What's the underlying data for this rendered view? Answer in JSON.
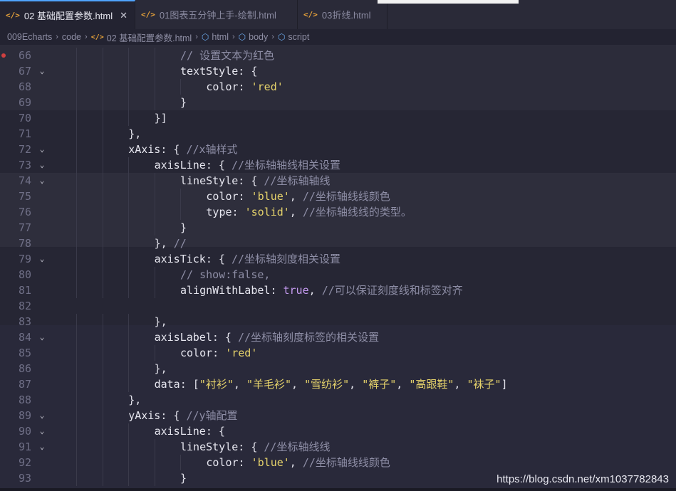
{
  "tabs": [
    {
      "icon": "</>",
      "label": "02 基础配置参数.html",
      "active": true,
      "close": "✕"
    },
    {
      "icon": "</>",
      "label": "01图表五分钟上手-绘制.html",
      "active": false
    },
    {
      "icon": "</>",
      "label": "03折线.html",
      "active": false
    }
  ],
  "breadcrumb": {
    "items": [
      "009Echarts",
      "code",
      "02 基础配置参数.html",
      "html",
      "body",
      "script"
    ],
    "separator": "›"
  },
  "editor": {
    "lines": [
      {
        "n": "66",
        "fold": false,
        "indent": 5,
        "tokens": [
          [
            "t-comment",
            "// 设置文本为红色"
          ]
        ]
      },
      {
        "n": "67",
        "fold": true,
        "indent": 5,
        "tokens": [
          [
            "t-key",
            "textStyle"
          ],
          [
            "t-punc",
            ": {"
          ]
        ]
      },
      {
        "n": "68",
        "fold": false,
        "indent": 6,
        "tokens": [
          [
            "t-key",
            "color"
          ],
          [
            "t-punc",
            ": "
          ],
          [
            "t-str",
            "'red'"
          ]
        ]
      },
      {
        "n": "69",
        "fold": false,
        "indent": 5,
        "tokens": [
          [
            "t-punc",
            "}"
          ]
        ]
      },
      {
        "n": "70",
        "fold": false,
        "indent": 4,
        "tokens": [
          [
            "t-punc",
            "}]"
          ]
        ]
      },
      {
        "n": "71",
        "fold": false,
        "indent": 3,
        "tokens": [
          [
            "t-punc",
            "},"
          ]
        ]
      },
      {
        "n": "72",
        "fold": true,
        "indent": 3,
        "tokens": [
          [
            "t-key",
            "xAxis"
          ],
          [
            "t-punc",
            ": { "
          ],
          [
            "t-comment",
            "//x轴样式"
          ]
        ]
      },
      {
        "n": "73",
        "fold": true,
        "indent": 4,
        "tokens": [
          [
            "t-key",
            "axisLine"
          ],
          [
            "t-punc",
            ": { "
          ],
          [
            "t-comment",
            "//坐标轴轴线相关设置"
          ]
        ]
      },
      {
        "n": "74",
        "fold": true,
        "indent": 5,
        "tokens": [
          [
            "t-key",
            "lineStyle"
          ],
          [
            "t-punc",
            ": { "
          ],
          [
            "t-comment",
            "//坐标轴轴线"
          ]
        ]
      },
      {
        "n": "75",
        "fold": false,
        "indent": 6,
        "tokens": [
          [
            "t-key",
            "color"
          ],
          [
            "t-punc",
            ": "
          ],
          [
            "t-str",
            "'blue'"
          ],
          [
            "t-punc",
            ", "
          ],
          [
            "t-comment",
            "//坐标轴线线颜色"
          ]
        ]
      },
      {
        "n": "76",
        "fold": false,
        "indent": 6,
        "tokens": [
          [
            "t-key",
            "type"
          ],
          [
            "t-punc",
            ": "
          ],
          [
            "t-str",
            "'solid'"
          ],
          [
            "t-punc",
            ", "
          ],
          [
            "t-comment",
            "//坐标轴线线的类型。"
          ]
        ]
      },
      {
        "n": "77",
        "fold": false,
        "indent": 5,
        "tokens": [
          [
            "t-punc",
            "}"
          ]
        ]
      },
      {
        "n": "78",
        "fold": false,
        "indent": 4,
        "tokens": [
          [
            "t-punc",
            "}, "
          ],
          [
            "t-comment",
            "//"
          ]
        ]
      },
      {
        "n": "79",
        "fold": true,
        "indent": 4,
        "tokens": [
          [
            "t-key",
            "axisTick"
          ],
          [
            "t-punc",
            ": { "
          ],
          [
            "t-comment",
            "//坐标轴刻度相关设置"
          ]
        ]
      },
      {
        "n": "80",
        "fold": false,
        "indent": 5,
        "tokens": [
          [
            "t-comment",
            "// show:false,"
          ]
        ]
      },
      {
        "n": "81",
        "fold": false,
        "indent": 5,
        "tokens": [
          [
            "t-key",
            "alignWithLabel"
          ],
          [
            "t-punc",
            ": "
          ],
          [
            "t-bool",
            "true"
          ],
          [
            "t-punc",
            ", "
          ],
          [
            "t-comment",
            "//可以保证刻度线和标签对齐"
          ]
        ]
      },
      {
        "n": "82",
        "fold": false,
        "indent": 0,
        "tokens": []
      },
      {
        "n": "83",
        "fold": false,
        "indent": 4,
        "tokens": [
          [
            "t-punc",
            "},"
          ]
        ]
      },
      {
        "n": "84",
        "fold": true,
        "indent": 4,
        "tokens": [
          [
            "t-key",
            "axisLabel"
          ],
          [
            "t-punc",
            ": { "
          ],
          [
            "t-comment",
            "//坐标轴刻度标签的相关设置"
          ]
        ]
      },
      {
        "n": "85",
        "fold": false,
        "indent": 5,
        "tokens": [
          [
            "t-key",
            "color"
          ],
          [
            "t-punc",
            ": "
          ],
          [
            "t-str",
            "'red'"
          ]
        ]
      },
      {
        "n": "86",
        "fold": false,
        "indent": 4,
        "tokens": [
          [
            "t-punc",
            "},"
          ]
        ]
      },
      {
        "n": "87",
        "fold": false,
        "indent": 4,
        "tokens": [
          [
            "t-key",
            "data"
          ],
          [
            "t-punc",
            ": ["
          ],
          [
            "t-str",
            "\"衬衫\""
          ],
          [
            "t-punc",
            ", "
          ],
          [
            "t-str",
            "\"羊毛衫\""
          ],
          [
            "t-punc",
            ", "
          ],
          [
            "t-str",
            "\"雪纺衫\""
          ],
          [
            "t-punc",
            ", "
          ],
          [
            "t-str",
            "\"裤子\""
          ],
          [
            "t-punc",
            ", "
          ],
          [
            "t-str",
            "\"高跟鞋\""
          ],
          [
            "t-punc",
            ", "
          ],
          [
            "t-str",
            "\"袜子\""
          ],
          [
            "t-punc",
            "]"
          ]
        ]
      },
      {
        "n": "88",
        "fold": false,
        "indent": 3,
        "tokens": [
          [
            "t-punc",
            "},"
          ]
        ]
      },
      {
        "n": "89",
        "fold": true,
        "indent": 3,
        "tokens": [
          [
            "t-key",
            "yAxis"
          ],
          [
            "t-punc",
            ": { "
          ],
          [
            "t-comment",
            "//y轴配置"
          ]
        ]
      },
      {
        "n": "90",
        "fold": true,
        "indent": 4,
        "tokens": [
          [
            "t-key",
            "axisLine"
          ],
          [
            "t-punc",
            ": {"
          ]
        ]
      },
      {
        "n": "91",
        "fold": true,
        "indent": 5,
        "tokens": [
          [
            "t-key",
            "lineStyle"
          ],
          [
            "t-punc",
            ": { "
          ],
          [
            "t-comment",
            "//坐标轴线线"
          ]
        ]
      },
      {
        "n": "92",
        "fold": false,
        "indent": 6,
        "tokens": [
          [
            "t-key",
            "color"
          ],
          [
            "t-punc",
            ": "
          ],
          [
            "t-str",
            "'blue'"
          ],
          [
            "t-punc",
            ", "
          ],
          [
            "t-comment",
            "//坐标轴线线颜色"
          ]
        ]
      },
      {
        "n": "93",
        "fold": false,
        "indent": 5,
        "tokens": [
          [
            "t-punc",
            "}"
          ]
        ]
      }
    ]
  },
  "watermark": "https://blog.csdn.net/xm1037782843",
  "colors": {
    "background": "#262634",
    "accent": "#4fa3ff",
    "string": "#e6d36b",
    "comment": "#8e8ea6",
    "boolean": "#c69cf2",
    "breakpoint": "#d04040"
  }
}
